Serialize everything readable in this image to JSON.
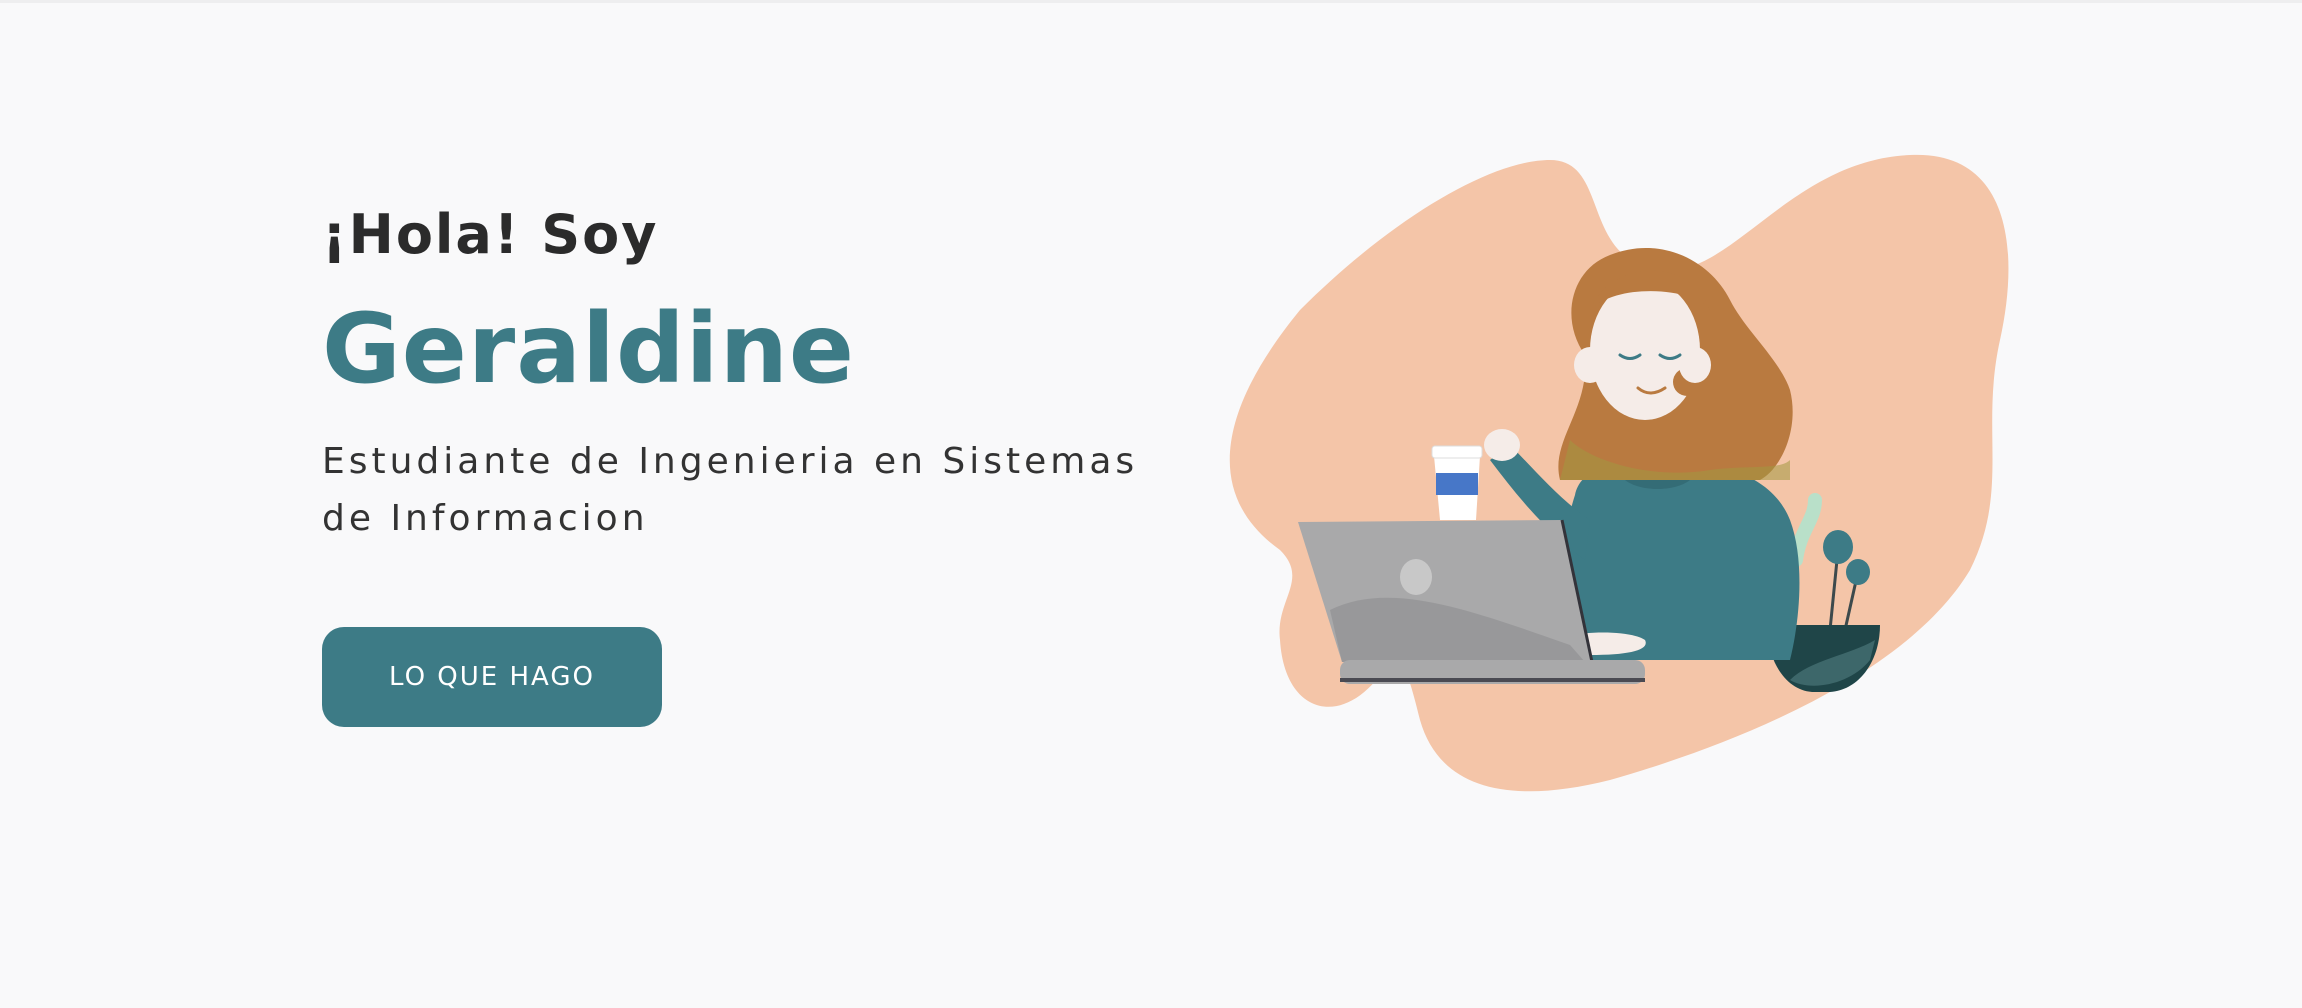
{
  "hero": {
    "greeting": "¡Hola! Soy",
    "name": "Geraldine",
    "subtitle": "Estudiante de Ingenieria en Sistemas de Informacion",
    "cta_label": "LO QUE HAGO"
  },
  "colors": {
    "background": "#f9f9fa",
    "accent": "#3d7b86",
    "blob": "#f4c5a8",
    "text": "#2b2b2b"
  },
  "illustration": {
    "icon": "woman-with-laptop-illustration"
  }
}
